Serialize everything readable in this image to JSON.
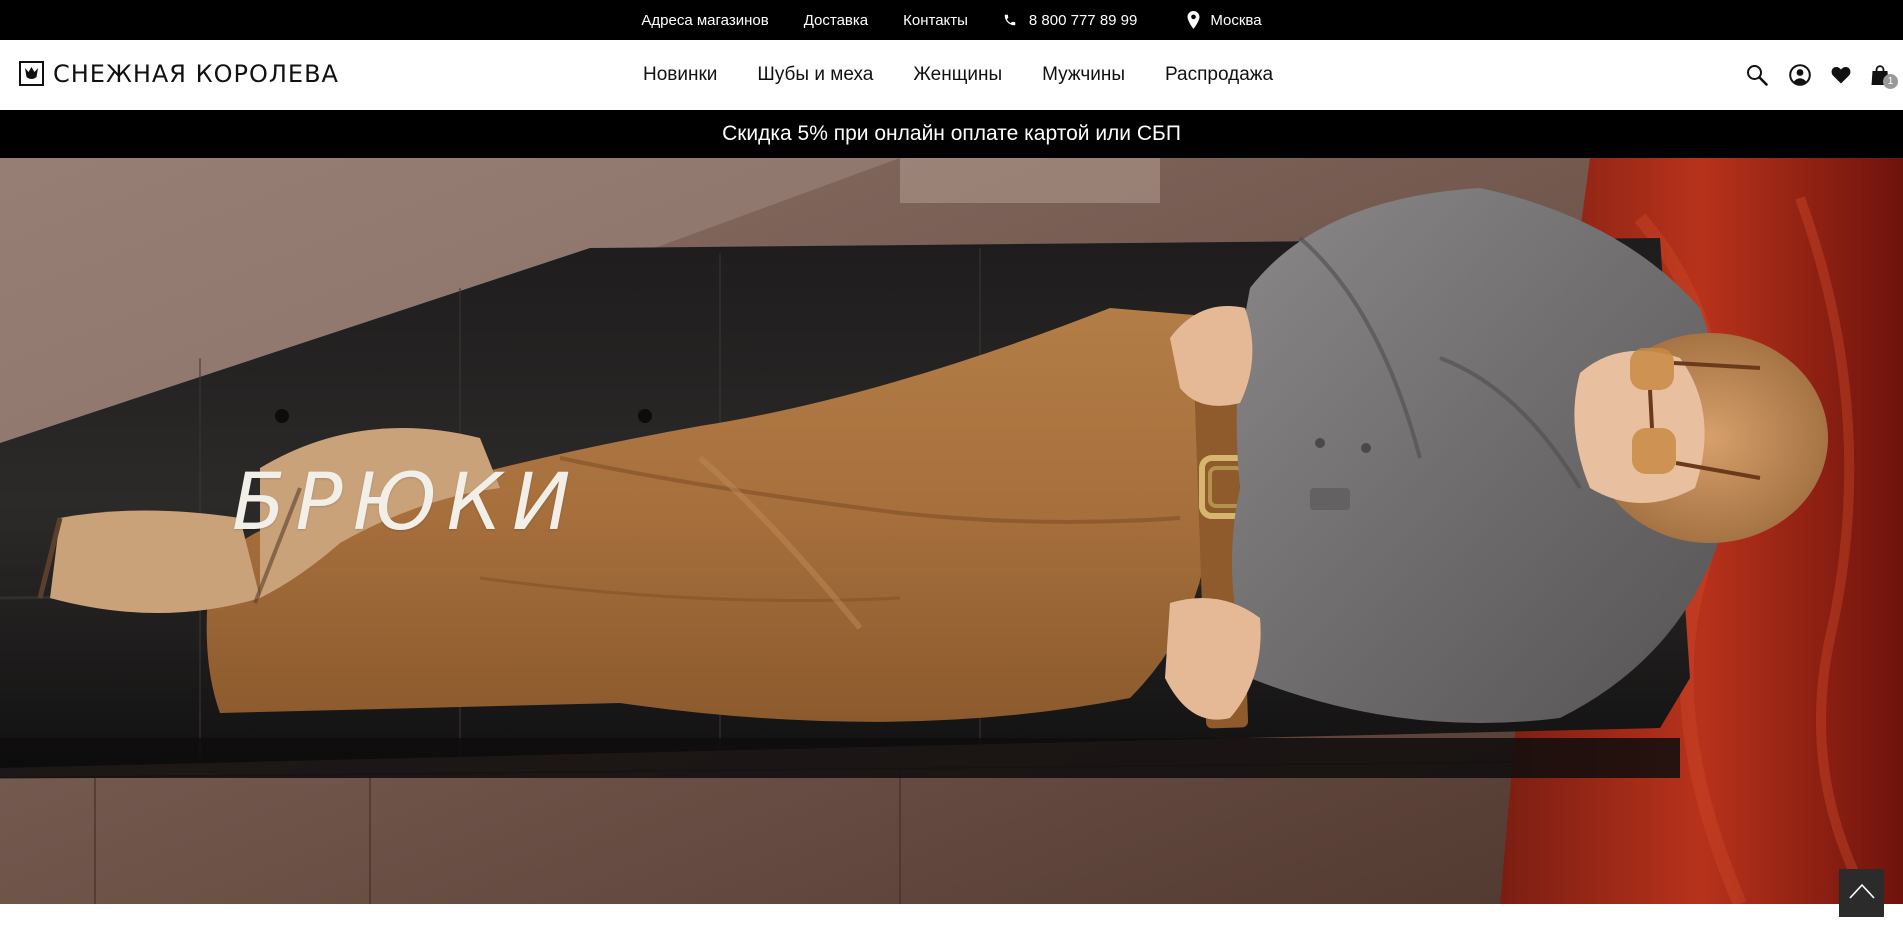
{
  "topbar": {
    "stores_label": "Адреса магазинов",
    "delivery_label": "Доставка",
    "contacts_label": "Контакты",
    "phone": "8 800 777 89 99",
    "city": "Москва"
  },
  "header": {
    "logo_text": "СНЕЖНАЯ КОРОЛЕВА",
    "nav": [
      {
        "label": "Новинки"
      },
      {
        "label": "Шубы и меха"
      },
      {
        "label": "Женщины"
      },
      {
        "label": "Мужчины"
      },
      {
        "label": "Распродажа"
      }
    ],
    "cart_count": "1"
  },
  "promo": {
    "text": "Скидка 5% при онлайн оплате картой или СБП"
  },
  "hero": {
    "title": "БРЮКИ"
  },
  "icons": {
    "phone": "phone-icon",
    "location": "location-pin-icon",
    "logo": "crown-logo-icon",
    "search": "search-icon",
    "account": "user-icon",
    "favorites": "heart-icon",
    "cart": "shopping-bag-icon",
    "scroll_top": "chevron-up-icon"
  }
}
